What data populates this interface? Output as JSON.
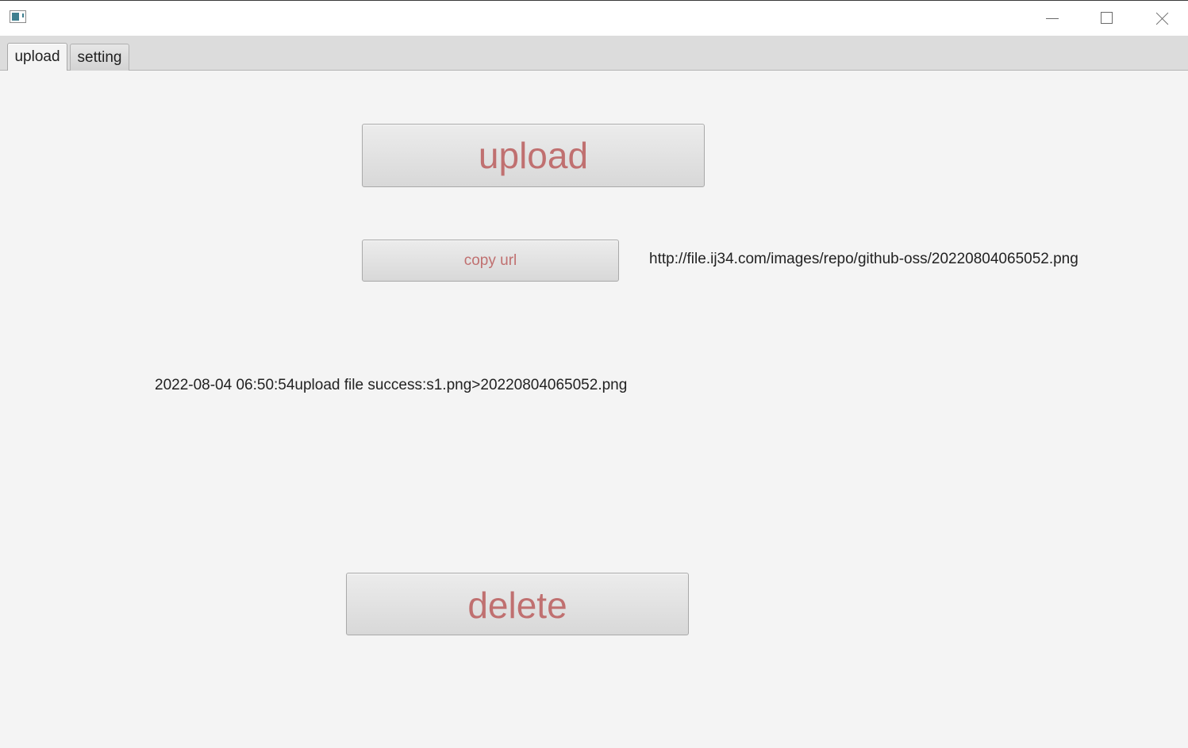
{
  "window": {
    "icon": "app-window-icon",
    "controls": {
      "minimize_icon": "minimize-icon",
      "maximize_icon": "maximize-icon",
      "close_icon": "close-icon"
    }
  },
  "tabs": [
    {
      "label": "upload",
      "active": true
    },
    {
      "label": "setting",
      "active": false
    }
  ],
  "main": {
    "upload_label": "upload",
    "copy_url_label": "copy url",
    "url_text": "http://file.ij34.com/images/repo/github-oss/20220804065052.png",
    "log_text": "2022-08-04 06:50:54upload file success:s1.png>20220804065052.png",
    "delete_label": "delete"
  },
  "colors": {
    "button_text": "#c07070",
    "background": "#f4f4f4",
    "tabbar": "#dcdcdc"
  }
}
